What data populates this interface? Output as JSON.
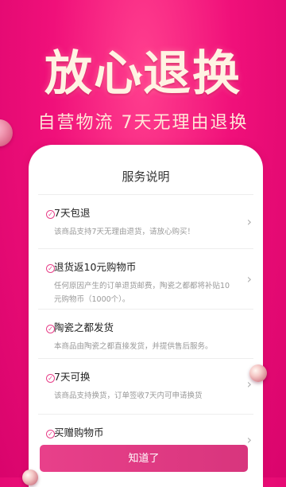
{
  "hero": {
    "title": "放心退换",
    "subtitle": "自营物流 7天无理由退换"
  },
  "card": {
    "title": "服务说明",
    "items": [
      {
        "name": "7天包退",
        "desc": "该商品支持7天无理由退货，请放心购买！"
      },
      {
        "name": "退货返10元购物币",
        "desc": "任何原因产生的订单退货邮费，陶瓷之都都将补贴10元购物币（1000个）。"
      },
      {
        "name": "陶瓷之都发货",
        "desc": "本商品由陶瓷之都直接发货，并提供售后服务。"
      },
      {
        "name": "7天可换",
        "desc": "该商品支持换货，订单签收7天内可申请换货"
      },
      {
        "name": "买赠购物币",
        "desc": ""
      }
    ]
  },
  "button": {
    "label": "知道了"
  },
  "colors": {
    "brand_pink": "#e8408a",
    "background": "#f0107a"
  },
  "icons": {
    "check": "check-circle-icon",
    "chevron": "chevron-right-icon"
  }
}
